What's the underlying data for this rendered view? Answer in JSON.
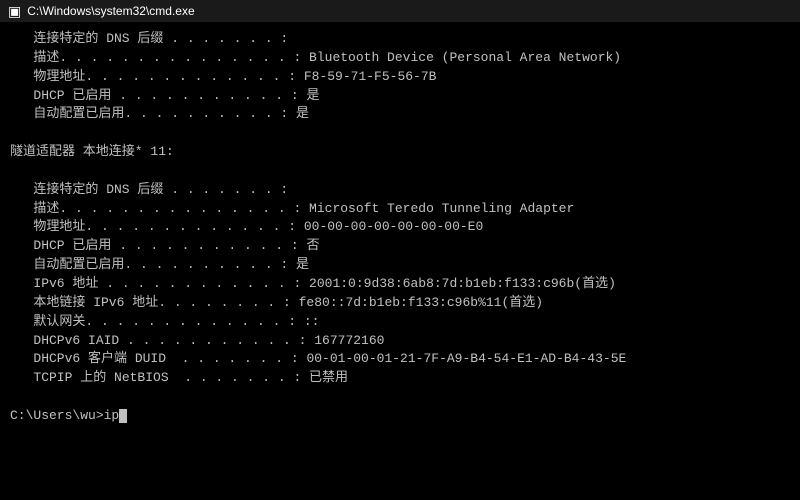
{
  "titleBar": {
    "icon": "■",
    "title": "C:\\Windows\\system32\\cmd.exe"
  },
  "terminal": {
    "lines": [
      "   连接特定的 DNS 后缀 . . . . . . . :",
      "   描述. . . . . . . . . . . . . . . : Bluetooth Device (Personal Area Network)",
      "   物理地址. . . . . . . . . . . . . : F8-59-71-F5-56-7B",
      "   DHCP 已启用 . . . . . . . . . . . : 是",
      "   自动配置已启用. . . . . . . . . . : 是",
      "",
      "隧道适配器 本地连接* 11:",
      "",
      "   连接特定的 DNS 后缀 . . . . . . . :",
      "   描述. . . . . . . . . . . . . . . : Microsoft Teredo Tunneling Adapter",
      "   物理地址. . . . . . . . . . . . . : 00-00-00-00-00-00-00-E0",
      "   DHCP 已启用 . . . . . . . . . . . : 否",
      "   自动配置已启用. . . . . . . . . . : 是",
      "   IPv6 地址 . . . . . . . . . . . . : 2001:0:9d38:6ab8:7d:b1eb:f133:c96b(首选)",
      "   本地链接 IPv6 地址. . . . . . . . : fe80::7d:b1eb:f133:c96b%11(首选)",
      "   默认网关. . . . . . . . . . . . . : ::",
      "   DHCPv6 IAID . . . . . . . . . . . : 167772160",
      "   DHCPv6 客户端 DUID  . . . . . . . : 00-01-00-01-21-7F-A9-B4-54-E1-AD-B4-43-5E",
      "   TCPIP 上的 NetBIOS  . . . . . . . : 已禁用",
      "",
      "C:\\Users\\wu>ip"
    ],
    "prompt": "C:\\Users\\wu>ip"
  }
}
